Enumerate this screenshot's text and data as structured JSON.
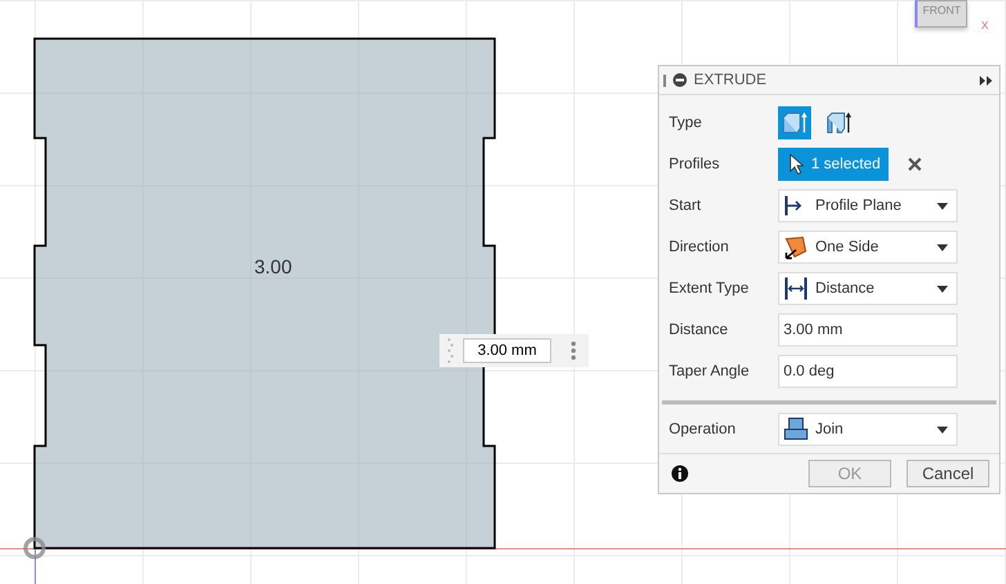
{
  "viewport": {
    "sketch_dimension": "3.00",
    "dimension_input": {
      "value": "3.00 mm"
    },
    "view_cube": {
      "face": "FRONT",
      "axis": "X"
    }
  },
  "dialog": {
    "title": "EXTRUDE",
    "rows": [
      {
        "kind": "type",
        "label": "Type",
        "options": [
          {
            "selected": true
          },
          {
            "selected": false
          }
        ]
      },
      {
        "kind": "selection",
        "label": "Profiles",
        "value": "1 selected"
      },
      {
        "kind": "dropdown",
        "label": "Start",
        "value": "Profile Plane"
      },
      {
        "kind": "dropdown",
        "label": "Direction",
        "value": "One Side"
      },
      {
        "kind": "dropdown",
        "label": "Extent Type",
        "value": "Distance"
      },
      {
        "kind": "input",
        "label": "Distance",
        "value": "3.00 mm"
      },
      {
        "kind": "input",
        "label": "Taper Angle",
        "value": "0.0 deg"
      }
    ],
    "operation": {
      "label": "Operation",
      "value": "Join"
    },
    "buttons": [
      {
        "label": "OK",
        "disabled": true
      },
      {
        "label": "Cancel",
        "disabled": false
      }
    ]
  }
}
